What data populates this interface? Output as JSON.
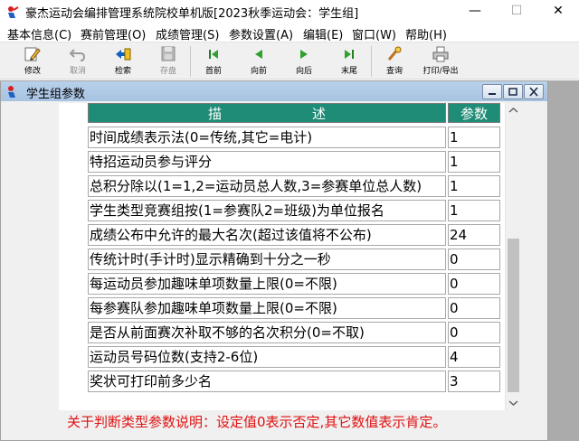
{
  "window": {
    "title": "豪杰运动会编排管理系统院校单机版[2023秋季运动会：学生组]",
    "minimize": "—",
    "maximize": "☐",
    "close": "✕"
  },
  "menu": {
    "items": [
      {
        "label": "基本信息(C)"
      },
      {
        "label": "赛前管理(O)"
      },
      {
        "label": "成绩管理(S)"
      },
      {
        "label": "参数设置(A)"
      },
      {
        "label": "编辑(E)"
      },
      {
        "label": "窗口(W)"
      },
      {
        "label": "帮助(H)"
      }
    ]
  },
  "toolbar": {
    "buttons": [
      {
        "label": "修改",
        "icon": "pencil-icon",
        "enabled": true
      },
      {
        "label": "取消",
        "icon": "undo-icon",
        "enabled": false
      },
      {
        "label": "检索",
        "icon": "search-arrow-icon",
        "enabled": true
      },
      {
        "label": "存盘",
        "icon": "floppy-disk-icon",
        "enabled": false
      },
      {
        "label": "首前",
        "icon": "first-record-icon",
        "enabled": true
      },
      {
        "label": "向前",
        "icon": "previous-record-icon",
        "enabled": true
      },
      {
        "label": "向后",
        "icon": "next-record-icon",
        "enabled": true
      },
      {
        "label": "末尾",
        "icon": "last-record-icon",
        "enabled": true
      },
      {
        "label": "查询",
        "icon": "query-icon",
        "enabled": true
      },
      {
        "label": "打印/导出",
        "icon": "printer-icon",
        "enabled": true
      }
    ]
  },
  "child_window": {
    "title": "学生组参数"
  },
  "grid": {
    "headers": {
      "desc_chars": [
        "描",
        "述"
      ],
      "param": "参数"
    },
    "rows": [
      {
        "desc": "时间成绩表示法(0=传统,其它=电计)",
        "value": "1"
      },
      {
        "desc": "特招运动员参与评分",
        "value": "1"
      },
      {
        "desc": "总积分除以(1=1,2=运动员总人数,3=参赛单位总人数)",
        "value": "1"
      },
      {
        "desc": "学生类型竞赛组按(1=参赛队2=班级)为单位报名",
        "value": "1"
      },
      {
        "desc": "成绩公布中允许的最大名次(超过该值将不公布)",
        "value": "24"
      },
      {
        "desc": "传统计时(手计时)显示精确到十分之一秒",
        "value": "0"
      },
      {
        "desc": "每运动员参加趣味单项数量上限(0=不限)",
        "value": "0"
      },
      {
        "desc": "每参赛队参加趣味单项数量上限(0=不限)",
        "value": "0"
      },
      {
        "desc": "是否从前面赛次补取不够的名次积分(0=不取)",
        "value": "0"
      },
      {
        "desc": "运动员号码位数(支持2-6位)",
        "value": "4"
      },
      {
        "desc": "奖状可打印前多少名",
        "value": "3"
      }
    ]
  },
  "note": "关于判断类型参数说明：设定值0表示否定,其它数值表示肯定。",
  "colors": {
    "header_bg": "#1e8c76",
    "note_text": "#e01010",
    "child_title_bg": "#b9d1ea"
  }
}
